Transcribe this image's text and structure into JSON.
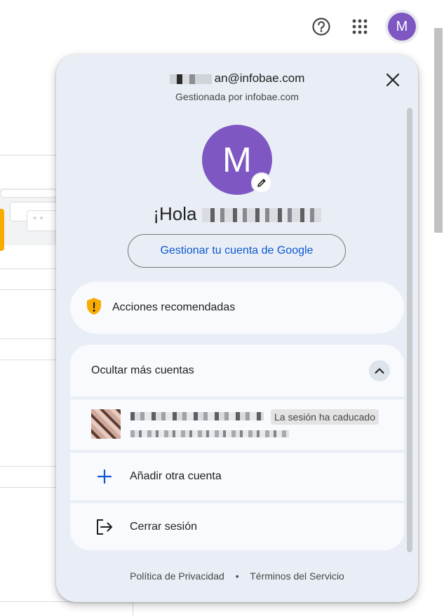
{
  "topbar": {
    "help_icon": "help-circle-icon",
    "apps_icon": "apps-grid-icon",
    "avatar_initial": "M"
  },
  "panel": {
    "email_visible": "an@infobae.com",
    "managed_by": "Gestionada por infobae.com",
    "close_icon": "close-icon",
    "avatar_initial": "M",
    "edit_icon": "pencil-icon",
    "greeting_prefix": "¡Hola",
    "manage_button": "Gestionar tu cuenta de Google",
    "recommended": {
      "icon": "warning-shield-icon",
      "label": "Acciones recomendadas"
    },
    "accounts": {
      "header": "Ocultar más cuentas",
      "toggle_icon": "chevron-up-icon",
      "user_badge": "La sesión ha caducado",
      "add_label": "Añadir otra cuenta",
      "add_icon": "plus-icon",
      "logout_label": "Cerrar sesión",
      "logout_icon": "logout-icon"
    },
    "footer": {
      "privacy": "Política de Privacidad",
      "separator": "•",
      "terms": "Términos del Servicio"
    }
  },
  "colors": {
    "accent": "#0b57d0",
    "avatar": "#7e57c2",
    "panel_bg": "#e9eef6",
    "card_bg": "#f8fafd",
    "warning": "#f9ab00"
  }
}
